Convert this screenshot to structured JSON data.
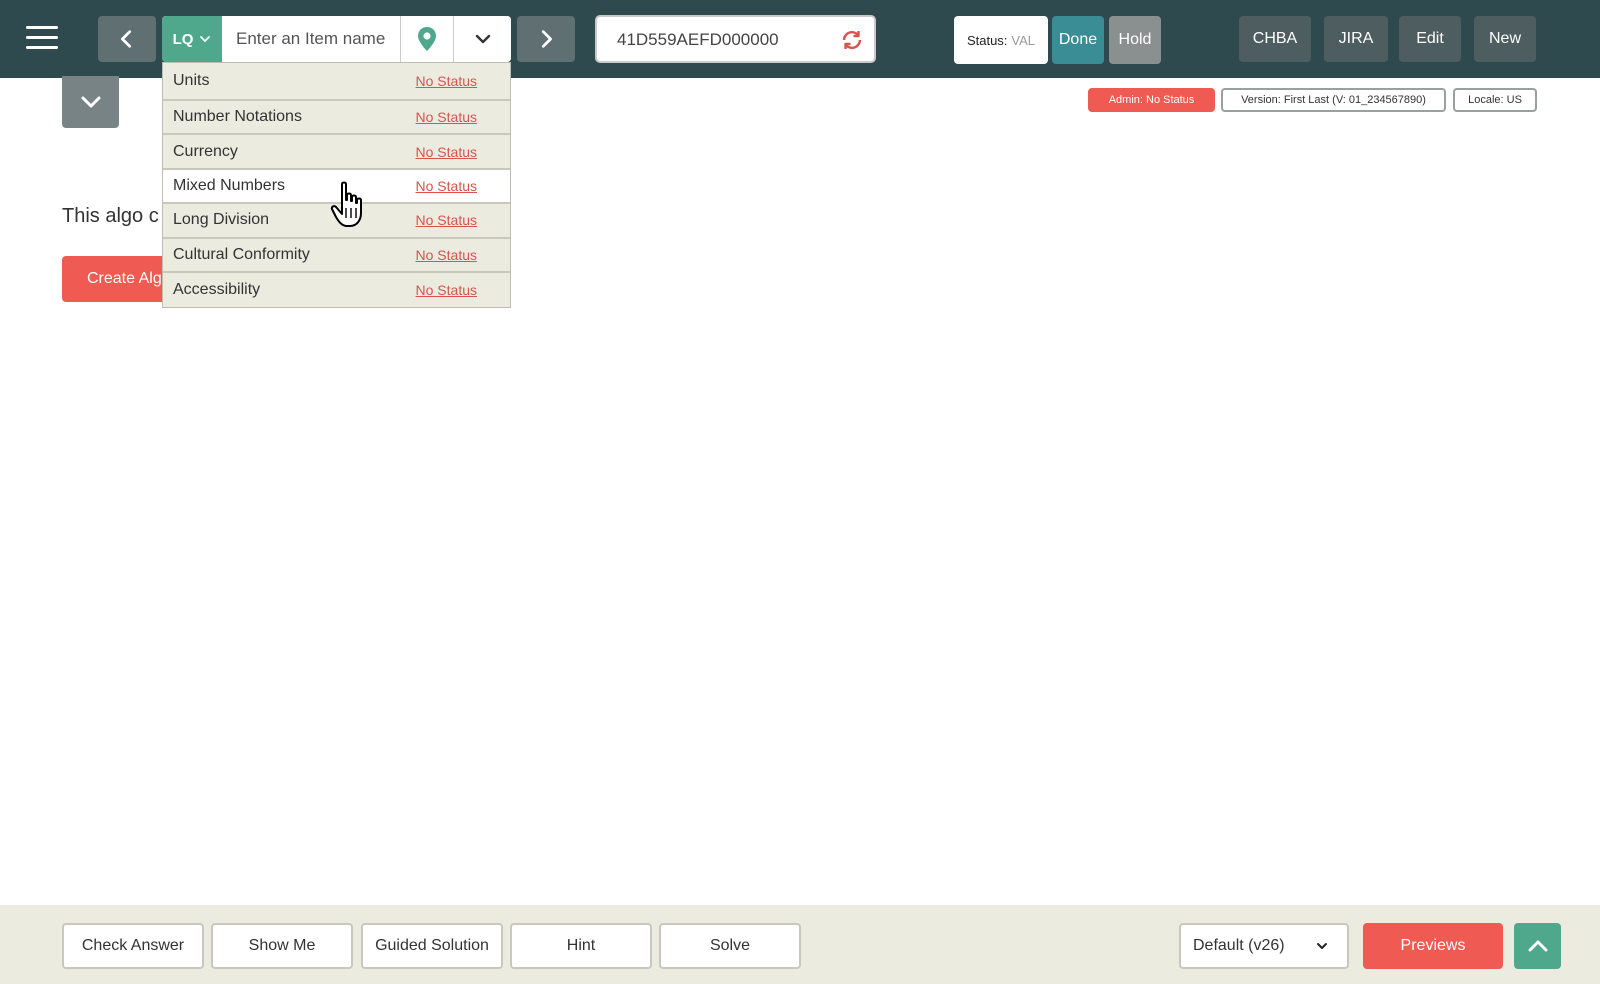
{
  "header": {
    "item_type": "LQ",
    "item_placeholder": "Enter an Item name",
    "item_id": "41D559AEFD000000",
    "status_label": "Status:",
    "status_value": "VAL",
    "done_label": "Done",
    "hold_label": "Hold",
    "buttons": [
      "CHBA",
      "JIRA",
      "Edit",
      "New"
    ]
  },
  "badges": {
    "admin": "Admin: No Status",
    "version": "Version: First Last (V: 01_234567890)",
    "locale": "Locale: US"
  },
  "main": {
    "algo_text": "This algo c",
    "create_button": "Create Alg"
  },
  "dropdown": {
    "hovered_index": 3,
    "items": [
      {
        "label": "Units",
        "status": "No Status"
      },
      {
        "label": "Number Notations",
        "status": "No Status"
      },
      {
        "label": "Currency",
        "status": "No Status"
      },
      {
        "label": "Mixed Numbers",
        "status": "No Status"
      },
      {
        "label": "Long Division",
        "status": "No Status"
      },
      {
        "label": "Cultural Conformity",
        "status": "No Status"
      },
      {
        "label": "Accessibility",
        "status": "No Status"
      }
    ]
  },
  "footer": {
    "buttons": [
      "Check Answer",
      "Show Me",
      "Guided Solution",
      "Hint",
      "Solve"
    ],
    "version_select": "Default (v26)",
    "previews_label": "Previews"
  },
  "colors": {
    "topbar": "#2f4a4f",
    "accent_green": "#4fa88c",
    "accent_red": "#ef5b52",
    "done_teal": "#3a8d95"
  },
  "icons": [
    "menu-icon",
    "chevron-left-icon",
    "chevron-down-icon",
    "map-pin-icon",
    "chevron-right-icon",
    "refresh-icon",
    "chevron-up-icon",
    "hand-cursor-icon"
  ]
}
